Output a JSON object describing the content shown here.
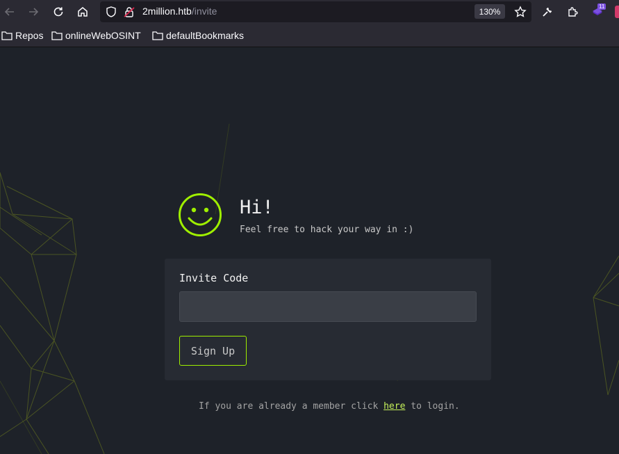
{
  "browser": {
    "url_host": "2million.htb",
    "url_path": "/invite",
    "zoom": "130%",
    "extension_badge": "11",
    "bookmarks": [
      {
        "label": "Repos"
      },
      {
        "label": "onlineWebOSINT"
      },
      {
        "label": "defaultBookmarks"
      }
    ]
  },
  "hero": {
    "greeting": "Hi!",
    "tagline": "Feel free to hack your way in :)"
  },
  "form": {
    "label": "Invite Code",
    "value": "",
    "button": "Sign Up"
  },
  "footer": {
    "prefix": "If you are already a member click ",
    "link": "here",
    "suffix": " to login."
  },
  "colors": {
    "accent": "#9fef00",
    "page_bg": "#1e2229",
    "card_bg": "#272b33"
  }
}
